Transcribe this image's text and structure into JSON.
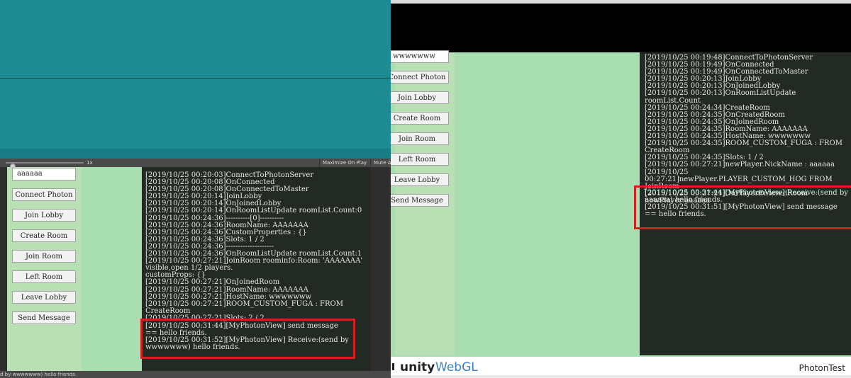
{
  "left_view": {
    "toolbar": {
      "scale": "1x",
      "maximize_on_play": "Maximize On Play",
      "mute_audio": "Mute Audio"
    },
    "room_input": "aaaaaa",
    "buttons": [
      "Connect Photon",
      "Join Lobby",
      "Create Room",
      "Join Room",
      "Left Room",
      "Leave Lobby",
      "Send Message"
    ],
    "log_lines": [
      "[2019/10/25 00:20:03]ConnectToPhotonServer",
      "[2019/10/25 00:20:08]OnConnected",
      "[2019/10/25 00:20:08]OnConnectedToMaster",
      "[2019/10/25 00:20:14]JoinLobby",
      "[2019/10/25 00:20:14]OnJoinedLobby",
      "[2019/10/25 00:20:14]OnRoomListUpdate roomList.Count:0",
      "[2019/10/25 00:24:36]----------[0]----------",
      "[2019/10/25 00:24:36]RoomName: AAAAAAA",
      "[2019/10/25 00:24:36]CustomProperties : {}",
      "[2019/10/25 00:24:36]Slots: 1 / 2",
      "[2019/10/25 00:24:36]--------------------",
      "[2019/10/25 00:24:36]OnRoomListUpdate roomList.Count:1",
      "[2019/10/25 00:27:21]JoinRoom roominfo:Room: 'AAAAAAA' visible,open 1/2 players.",
      "customProps: {}",
      "[2019/10/25 00:27:21]OnJoinedRoom",
      "[2019/10/25 00:27:21]RoomName: AAAAAAA",
      "[2019/10/25 00:27:21]HostName: wwwwwww",
      "[2019/10/25 00:27:21]ROOM_CUSTOM_FUGA : FROM CreateRoom",
      "[2019/10/25 00:27:21]Slots: 2 / 2"
    ],
    "highlight_lines": [
      "[2019/10/25 00:31:44][MyPhotonView] send message == hello friends.",
      "[2019/10/25 00:31:52][MyPhotonView] Receive:(send by wwwwwww) hello friends."
    ],
    "status_text": "d by wwwwwww) hello friends."
  },
  "right_view": {
    "room_input": "wwwwwww",
    "buttons": [
      "Connect Photon",
      "Join Lobby",
      "Create Room",
      "Join Room",
      "Left Room",
      "Leave Lobby",
      "Send Message"
    ],
    "log_lines": [
      "[2019/10/25 00:19:48]ConnectToPhotonServer",
      "[2019/10/25 00:19:49]OnConnected",
      "[2019/10/25 00:19:49]OnConnectedToMaster",
      "[2019/10/25 00:20:13]JoinLobby",
      "[2019/10/25 00:20:13]OnJoinedLobby",
      "[2019/10/25 00:20:13]OnRoomListUpdate roomList.Count",
      "[2019/10/25 00:24:34]CreateRoom",
      "[2019/10/25 00:24:35]OnCreatedRoom",
      "[2019/10/25 00:24:35]OnJoinedRoom",
      "[2019/10/25 00:24:35]RoomName: AAAAAAA",
      "[2019/10/25 00:24:35]HostName: wwwwwww",
      "[2019/10/25 00:24:35]ROOM_CUSTOM_FUGA : FROM CreateRoom",
      "[2019/10/25 00:24:35]Slots: 1 / 2",
      "[2019/10/25 00:27:21]newPlayer.NickName : aaaaaa",
      "[2019/10/25 00:27:21]newPlayer.PLAYER_CUSTOM_HOG FROM JoinRoom",
      "[2019/10/25 00:27:21]OnPlayerEnteredRoom",
      "newPlayer:aaaaaa"
    ],
    "highlight_lines": [
      "[2019/10/25 00:31:44][MyPhotonView] Receive:(send by aaaaaa) hello friends.",
      "[2019/10/25 00:31:51][MyPhotonView] send message == hello friends."
    ],
    "footer": {
      "logo_unity": "unity",
      "logo_webgl": "WebGL",
      "title": "PhotonTest"
    }
  },
  "colors": {
    "highlight": "#d62020",
    "teal": "#1e8a92",
    "green": "#a9deb0",
    "log_bg": "#232923"
  }
}
